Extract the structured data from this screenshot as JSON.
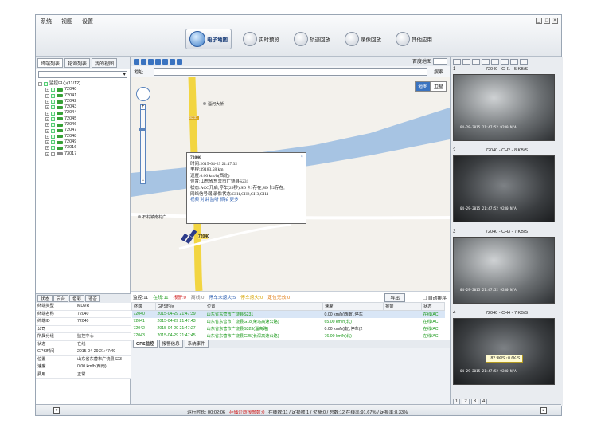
{
  "menu": [
    "系统",
    "视图",
    "设置"
  ],
  "window_buttons": [
    "_",
    "□",
    "×"
  ],
  "modules": [
    {
      "label": "电子地图",
      "active": true
    },
    {
      "label": "实时预览",
      "active": false
    },
    {
      "label": "轨迹回放",
      "active": false
    },
    {
      "label": "录像回放",
      "active": false
    },
    {
      "label": "其他应用",
      "active": false
    }
  ],
  "left_tabs": [
    "终端列表",
    "轮询列表",
    "我的视图"
  ],
  "tree": {
    "root": "监控中心(11/12)",
    "children": [
      {
        "label": "72040",
        "online": true
      },
      {
        "label": "72041",
        "online": true
      },
      {
        "label": "72042",
        "online": true
      },
      {
        "label": "72043",
        "online": true
      },
      {
        "label": "72044",
        "online": true
      },
      {
        "label": "72045",
        "online": true
      },
      {
        "label": "72046",
        "online": true
      },
      {
        "label": "72047",
        "online": true
      },
      {
        "label": "72048",
        "online": true
      },
      {
        "label": "72049",
        "online": true
      },
      {
        "label": "73016",
        "online": true
      },
      {
        "label": "73017",
        "online": false
      }
    ]
  },
  "info_tabs": [
    "状态",
    "云台",
    "色彩",
    "语音"
  ],
  "info_rows": [
    {
      "k": "终端类型",
      "v": "MDVR"
    },
    {
      "k": "终端名称",
      "v": "72040"
    },
    {
      "k": "终端ID",
      "v": "72040"
    },
    {
      "k": "公司",
      "v": ""
    },
    {
      "k": "所属分组",
      "v": "监控中心"
    },
    {
      "k": "状态",
      "v": "在线"
    },
    {
      "k": "GPS时间",
      "v": "2015-04-29 21:47:49"
    },
    {
      "k": "位置",
      "v": "山东省东营市广饶县S23"
    },
    {
      "k": "速度",
      "v": "0.00 km/h(西南)"
    },
    {
      "k": "费用",
      "v": "正常"
    }
  ],
  "map": {
    "type_select": "百度地图",
    "address_label": "地址",
    "search_button": "搜索",
    "map_types": [
      "地图",
      "卫星"
    ],
    "labels": {
      "bridge": "淄河大桥",
      "road": "S231",
      "village": "石村镇南村广",
      "marker": "72040"
    },
    "popup": {
      "title": "72046",
      "time": "时间:2015-04-29 21:47:32",
      "mileage": "里程:39183.58 km",
      "speed": "速度:0.00 km/h(西北)",
      "location": "位置:山东省东营市广饶县S231",
      "status": "状态:ACC开启,停车(29秒),SD卡1存在,SD卡2存在,",
      "network": "网络信号弱,录像状态:CH1,CH2,CH3,CH4",
      "links": "视频 对讲 监听 抓拍 更多",
      "close": "×"
    }
  },
  "status_line": {
    "monitor": "监控:11",
    "online": "在线:11",
    "alarm": "报警:0",
    "offline": "离线:0",
    "parked": "停车未熄火:5",
    "parked_off": "停车熄火:0",
    "invalid": "定位无效:0",
    "export": "导出",
    "auto_sort": "自动排序"
  },
  "grid": {
    "columns": [
      "终端",
      "GPS时间",
      "位置",
      "速度",
      "报警",
      "状态"
    ],
    "rows": [
      {
        "id": "72040",
        "time": "2015-04-29 21:47:39",
        "loc": "山东省东营市广饶县S231",
        "speed": "0.00 km/h(西南),停车",
        "alarm": "",
        "state": "在线/AC"
      },
      {
        "id": "72041",
        "time": "2015-04-29 21:47:43",
        "loc": "山东省东营市广饶县G18(荣乌高速公路)",
        "speed": "65.00 km/h(北)",
        "alarm": "",
        "state": "在线/AC"
      },
      {
        "id": "72042",
        "time": "2015-04-29 21:47:27",
        "loc": "山东省东营市广饶县S323(淄高路)",
        "speed": "0.00 km/h(南),停车(2",
        "alarm": "",
        "state": "在线/AC"
      },
      {
        "id": "72043",
        "time": "2015-04-29 21:47:45",
        "loc": "山东省东营市广饶县G25(长深高速公路)",
        "speed": "76.00 km/h(北)",
        "alarm": "",
        "state": "在线/AC"
      }
    ]
  },
  "bottom_tabs": [
    "GPS监控",
    "报警信息",
    "系统事件"
  ],
  "cameras": [
    {
      "num": "1",
      "title": "72040 - CH1 - 5 KB/S",
      "osd": "04-29-2015 21:47:52  9280 N/A"
    },
    {
      "num": "2",
      "title": "72040 - CH2 - 8 KB/S",
      "osd": "04-29-2015 21:47:52  9280 N/A"
    },
    {
      "num": "3",
      "title": "72040 - CH3 - 7 KB/S",
      "osd": "04-29-2015 21:47:52  9280 N/A"
    },
    {
      "num": "4",
      "title": "72040 - CH4 - 7 KB/S",
      "osd": "04-29-2015 21:47:52  9280 N/A",
      "badge": "↓82.9K/S  ↑0.6K/S"
    }
  ],
  "pager": [
    "1",
    "2",
    "3",
    "4"
  ],
  "bottom_bar": {
    "runtime": "运行时长: 00:02:06",
    "storage_alarm": "存储介质报警数:0",
    "stats": "在线数:11 / 定损数:1 / 欠费:0 / 总数:12   在线率:91.67% / 定损率:8.33%"
  }
}
